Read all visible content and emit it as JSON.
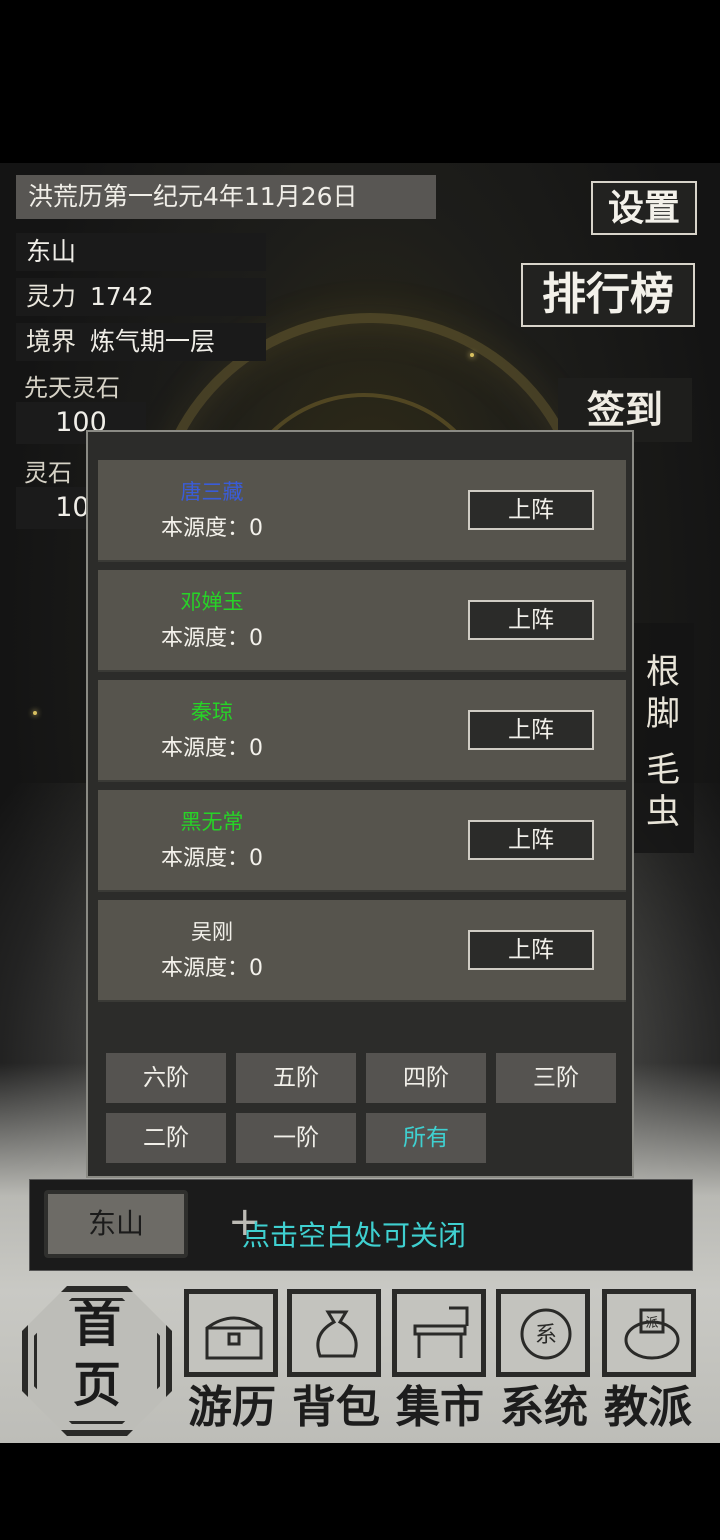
{
  "header": {
    "date": "洪荒历第一纪元4年11月26日",
    "location": "东山",
    "spirit_power_label": "灵力",
    "spirit_power_value": "1742",
    "realm_label": "境界",
    "realm_value": "炼气期一层",
    "innate_stone_label": "先天灵石",
    "innate_stone_value": "100",
    "stone_label": "灵石",
    "stone_value": "100"
  },
  "buttons": {
    "settings": "设置",
    "ranking": "排行榜",
    "sign_in": "签到"
  },
  "side_tag": {
    "line1": "根脚",
    "line2": "毛虫"
  },
  "modal": {
    "origin_label": "本源度：",
    "deploy_label": "上阵",
    "characters": [
      {
        "name": "唐三藏",
        "origin": "0",
        "color": "#3a5cd8"
      },
      {
        "name": "邓婵玉",
        "origin": "0",
        "color": "#27d327"
      },
      {
        "name": "秦琼",
        "origin": "0",
        "color": "#27d327"
      },
      {
        "name": "黑无常",
        "origin": "0",
        "color": "#27d327"
      },
      {
        "name": "吴刚",
        "origin": "0",
        "color": "#f2f0ea"
      }
    ],
    "tiers": [
      "六阶",
      "五阶",
      "四阶",
      "三阶",
      "二阶",
      "一阶",
      "所有"
    ],
    "active_tier_color": "#3fd0d0"
  },
  "bottom_bar": {
    "location_tab": "东山",
    "close_hint": "点击空白处可关闭"
  },
  "nav": {
    "home": "首页",
    "items": [
      {
        "label": "游历",
        "icon": "chest-icon"
      },
      {
        "label": "背包",
        "icon": "bag-icon"
      },
      {
        "label": "集市",
        "icon": "stall-icon"
      },
      {
        "label": "系统",
        "icon": "system-token-icon"
      },
      {
        "label": "教派",
        "icon": "sect-seal-icon"
      }
    ]
  }
}
